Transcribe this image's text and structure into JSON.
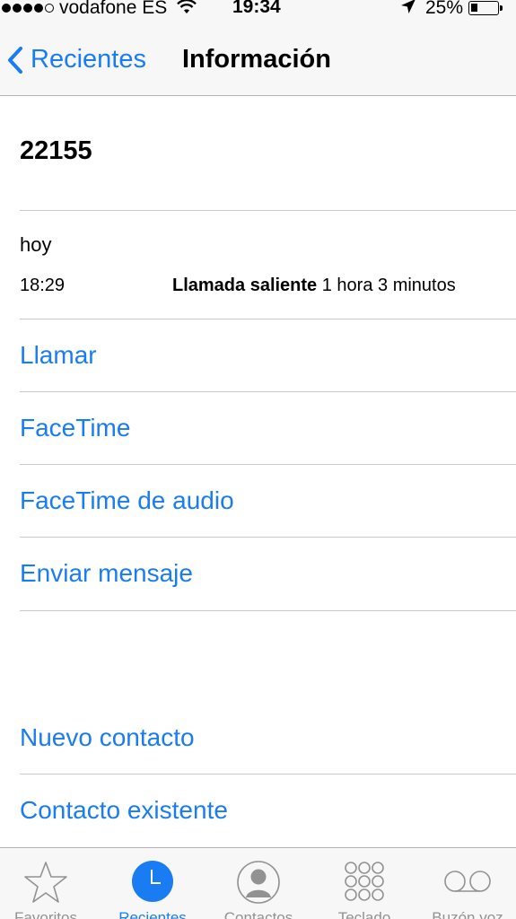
{
  "status_bar": {
    "carrier": "vodafone ES",
    "time": "19:34",
    "battery_percent": "25%",
    "signal_bars_filled": 4,
    "signal_bars_total": 5,
    "battery_level": 0.25
  },
  "nav": {
    "back_label": "Recientes",
    "title": "Información"
  },
  "contact": {
    "number": "22155"
  },
  "call_log": {
    "day": "hoy",
    "time": "18:29",
    "type": "Llamada saliente",
    "duration": "1 hora 3 minutos"
  },
  "actions": {
    "call": "Llamar",
    "facetime": "FaceTime",
    "facetime_audio": "FaceTime de audio",
    "message": "Enviar mensaje",
    "new_contact": "Nuevo contacto",
    "existing_contact": "Contacto existente"
  },
  "tabs": [
    {
      "label": "Favoritos",
      "icon": "star-icon",
      "active": false
    },
    {
      "label": "Recientes",
      "icon": "clock-icon",
      "active": true
    },
    {
      "label": "Contactos",
      "icon": "person-icon",
      "active": false
    },
    {
      "label": "Teclado",
      "icon": "keypad-icon",
      "active": false
    },
    {
      "label": "Buzón voz",
      "icon": "voicemail-icon",
      "active": false
    }
  ],
  "colors": {
    "accent": "#1a7cf2",
    "tab_inactive": "#929292"
  }
}
